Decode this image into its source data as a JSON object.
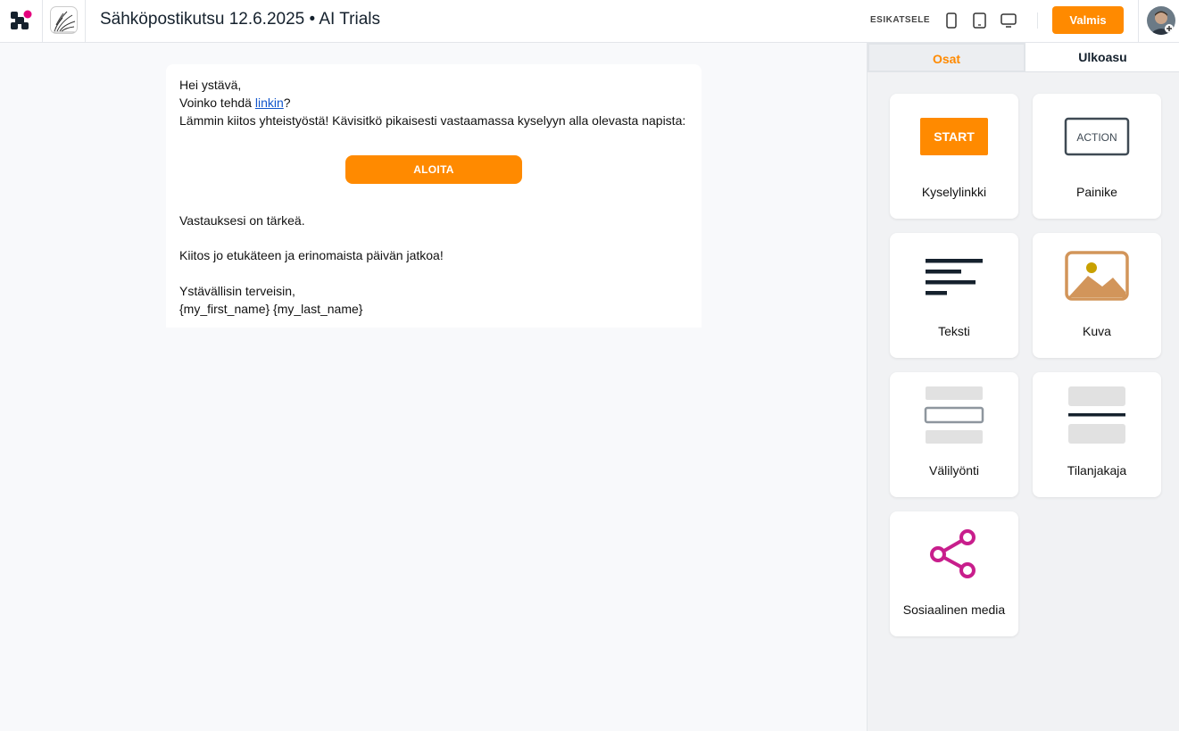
{
  "header": {
    "title": "Sähköpostikutsu 12.6.2025 • AI Trials",
    "preview_label": "ESIKATSELE",
    "done_label": "Valmis"
  },
  "email": {
    "greeting": "Hei ystävä,",
    "line2_prefix": "Voinko tehdä ",
    "line2_link": "linkin",
    "line2_suffix": "?",
    "line3": "Lämmin kiitos yhteistyöstä! Kävisitkö pikaisesti vastaamassa kyselyyn alla olevasta napista:",
    "button_label": "ALOITA",
    "line4": "Vastauksesi on tärkeä.",
    "line5": "Kiitos jo etukäteen ja erinomaista päivän jatkoa!",
    "line6": "Ystävällisin terveisin,",
    "line7": "{my_first_name} {my_last_name}"
  },
  "panel": {
    "tabs": [
      {
        "label": "Osat",
        "active": true
      },
      {
        "label": "Ulkoasu",
        "active": false
      }
    ],
    "tiles": [
      {
        "label": "Kyselylinkki",
        "art_text": "START"
      },
      {
        "label": "Painike",
        "art_text": "ACTION"
      },
      {
        "label": "Teksti"
      },
      {
        "label": "Kuva"
      },
      {
        "label": "Välilyönti"
      },
      {
        "label": "Tilanjakaja"
      },
      {
        "label": "Sosiaalinen media"
      }
    ]
  },
  "colors": {
    "accent": "#ff8a00",
    "brand_pink": "#e5007e",
    "brand_navy": "#15212d",
    "link": "#1155cc",
    "image_icon": "#d2955a",
    "share_icon": "#c81e8c"
  }
}
